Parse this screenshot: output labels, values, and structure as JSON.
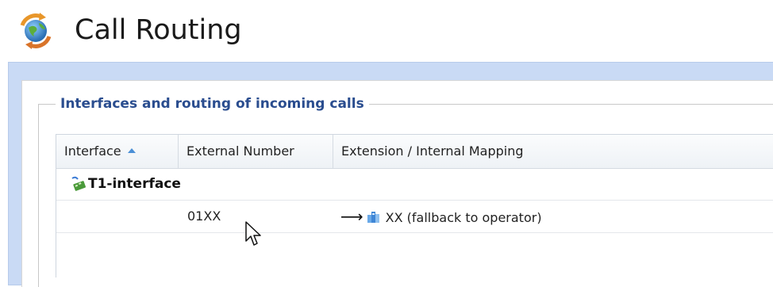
{
  "header": {
    "title": "Call Routing",
    "icon": "call-routing-globe-icon"
  },
  "section": {
    "legend": "Interfaces and routing of incoming calls"
  },
  "table": {
    "columns": [
      {
        "label": "Interface",
        "sorted": "ascending"
      },
      {
        "label": "External Number"
      },
      {
        "label": "Extension / Internal Mapping"
      }
    ],
    "groups": [
      {
        "label": "T1-interface",
        "icon": "t1-interface-icon",
        "rows": [
          {
            "external_number": "01XX",
            "arrow": "⟶",
            "extension_icon": "extension-group-icon",
            "extension": "XX (fallback to operator)"
          }
        ]
      }
    ]
  },
  "colors": {
    "legend": "#2a4d8f",
    "panel_background": "#c9daf5",
    "sort_arrow": "#4a8fd6"
  }
}
